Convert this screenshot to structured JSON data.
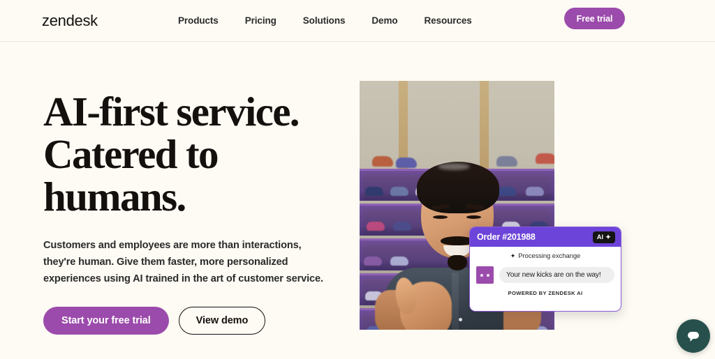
{
  "header": {
    "logo": "zendesk",
    "nav": [
      {
        "label": "Products"
      },
      {
        "label": "Pricing"
      },
      {
        "label": "Solutions"
      },
      {
        "label": "Demo"
      },
      {
        "label": "Resources"
      }
    ],
    "cta": {
      "label": "Free trial"
    }
  },
  "hero": {
    "headline": "AI-first service. Catered to humans.",
    "subcopy": "Customers and employees are more than interactions, they're human. Give them faster, more personalized experiences using AI trained in the art of customer service.",
    "primary_cta": "Start your free trial",
    "secondary_cta": "View demo"
  },
  "chat_card": {
    "title": "Order #201988",
    "ai_badge": "AI",
    "sparkle": "✦",
    "status": "Processing exchange",
    "message": "Your new kicks are on the way!",
    "footer": "POWERED BY ZENDESK AI"
  },
  "launcher": {
    "icon": "chat-bubble-icon"
  },
  "colors": {
    "page_bg": "#fdfbf4",
    "brand_purple": "#9b4bab",
    "chat_purple": "#6d44d9",
    "launcher_teal": "#27504c",
    "text_dark": "#14100e"
  }
}
